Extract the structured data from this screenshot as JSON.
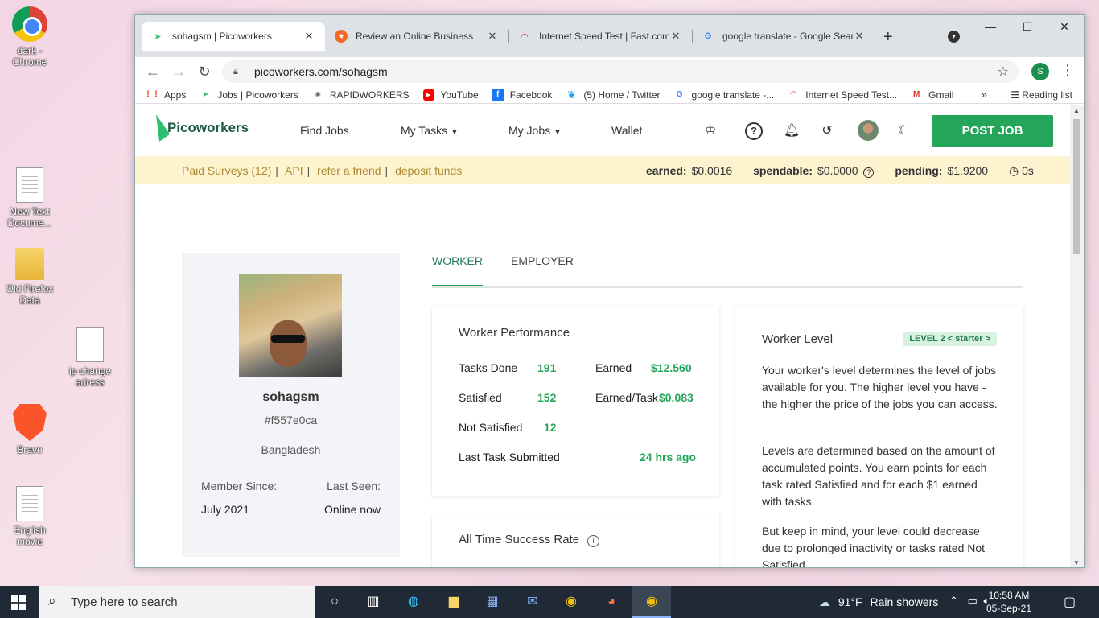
{
  "desktop": {
    "icons": [
      {
        "label": "dark - Chrome",
        "icon": "chrome-icon"
      },
      {
        "label": "New Text Docume...",
        "icon": "text-document-icon"
      },
      {
        "label": "Old Firefox Data",
        "icon": "folder-icon"
      },
      {
        "label": "ip change adress",
        "icon": "text-document-icon"
      },
      {
        "label": "Brave",
        "icon": "brave-icon"
      },
      {
        "label": "English movie",
        "icon": "text-document-icon"
      }
    ]
  },
  "browser": {
    "tabs": [
      {
        "title": "sohagsm | Picoworkers",
        "icon": "picoworkers-icon"
      },
      {
        "title": "Review an Online Business",
        "icon": "star-badge-icon"
      },
      {
        "title": "Internet Speed Test | Fast.com",
        "icon": "speedometer-icon"
      },
      {
        "title": "google translate - Google Sear",
        "icon": "google-icon"
      }
    ],
    "url": "picoworkers.com/sohagsm",
    "profile_initial": "S",
    "bookmarks": [
      {
        "label": "Apps",
        "icon": "apps-grid-icon"
      },
      {
        "label": "Jobs | Picoworkers",
        "icon": "picoworkers-icon"
      },
      {
        "label": "RAPIDWORKERS",
        "icon": "rapidworkers-icon"
      },
      {
        "label": "YouTube",
        "icon": "youtube-icon"
      },
      {
        "label": "Facebook",
        "icon": "facebook-icon"
      },
      {
        "label": "(5) Home / Twitter",
        "icon": "twitter-icon"
      },
      {
        "label": "google translate -...",
        "icon": "google-icon"
      },
      {
        "label": "Internet Speed Test...",
        "icon": "speedometer-icon"
      },
      {
        "label": "Gmail",
        "icon": "gmail-icon"
      }
    ],
    "reading_list": "Reading list"
  },
  "site": {
    "logo_text": "Picoworkers",
    "nav": {
      "find_jobs": "Find Jobs",
      "my_tasks": "My Tasks",
      "my_jobs": "My Jobs",
      "wallet": "Wallet",
      "post_job": "POST JOB"
    },
    "subbar": {
      "links": [
        "Paid Surveys (12)",
        "API",
        "refer a friend",
        "deposit funds"
      ],
      "earned_label": "earned:",
      "earned": "$0.0016",
      "spendable_label": "spendable:",
      "spendable": "$0.0000",
      "pending_label": "pending:",
      "pending": "$1.9200",
      "timer": "0s"
    },
    "profile": {
      "username": "sohagsm",
      "user_id": "#f557e0ca",
      "country": "Bangladesh",
      "member_since_label": "Member Since:",
      "member_since": "July 2021",
      "last_seen_label": "Last Seen:",
      "last_seen": "Online now"
    },
    "role_tabs": [
      "WORKER",
      "EMPLOYER"
    ],
    "performance": {
      "title": "Worker Performance",
      "tasks_done_label": "Tasks Done",
      "tasks_done": "191",
      "satisfied_label": "Satisfied",
      "satisfied": "152",
      "not_satisfied_label": "Not Satisfied",
      "not_satisfied": "12",
      "earned_label": "Earned",
      "earned": "$12.560",
      "earned_per_task_label": "Earned/Task",
      "earned_per_task": "$0.083",
      "last_task_label": "Last Task Submitted",
      "last_task": "24 hrs ago"
    },
    "level": {
      "title": "Worker Level",
      "badge": "LEVEL 2 < starter >",
      "p1": "Your worker's level determines the level of jobs available for you. The higher level you have - the higher the price of the jobs you can access.",
      "p2": "Levels are determined based on the amount of accumulated points. You earn points for each task rated Satisfied and for each $1 earned with tasks.",
      "p3": "But keep in mind, your level could decrease due to prolonged inactivity or tasks rated Not Satisfied."
    },
    "success": {
      "title": "All Time Success Rate"
    },
    "colors": {
      "accent_green": "#25a55a",
      "subbar_bg": "#fdf3cf",
      "subbar_link": "#b08a2f"
    }
  },
  "taskbar": {
    "search_placeholder": "Type here to search",
    "weather_temp": "91°F",
    "weather_text": "Rain showers",
    "time": "10:58 AM",
    "date": "05-Sep-21"
  }
}
